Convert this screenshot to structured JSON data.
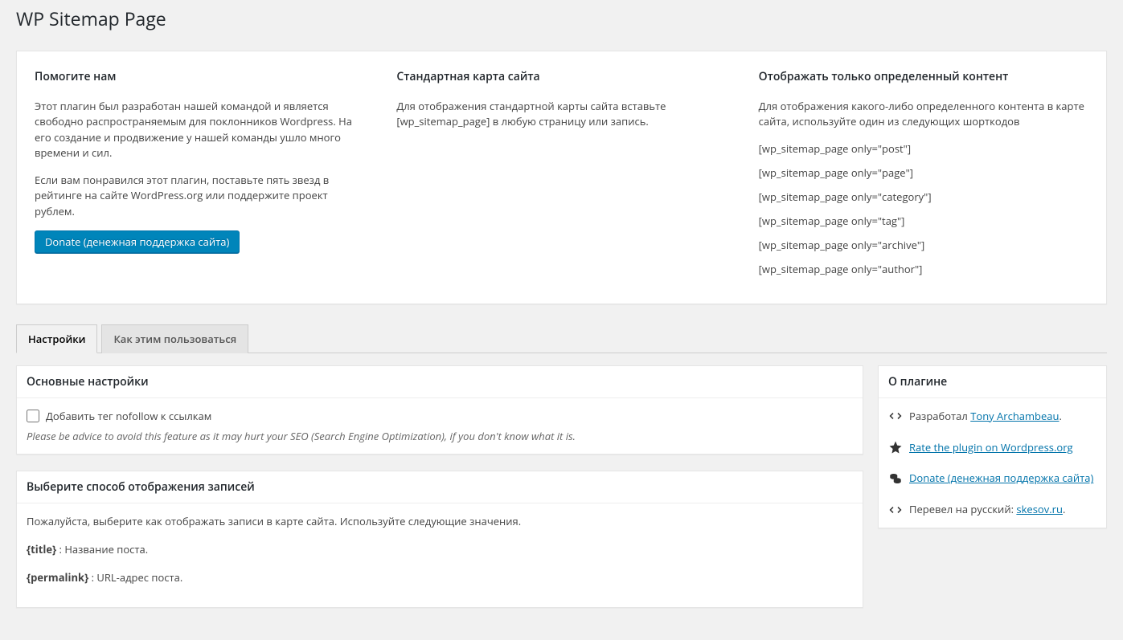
{
  "page_title": "WP Sitemap Page",
  "top": {
    "col1": {
      "heading": "Помогите нам",
      "p1": "Этот плагин был разработан нашей командой и является свободно распространяемым для поклонников Wordpress. На его создание и продвижение у нашей команды ушло много времени и сил.",
      "p2": "Если вам понравился этот плагин, поставьте пять звезд в рейтинге на сайте WordPress.org или поддержите проект рублем.",
      "donate_btn": "Donate (денежная поддержка сайта)"
    },
    "col2": {
      "heading": "Стандартная карта сайта",
      "p1": "Для отображения стандартной карты сайта вставьте [wp_sitemap_page] в любую страницу или запись."
    },
    "col3": {
      "heading": "Отображать только определенный контент",
      "p1": "Для отображения какого-либо определенного контента в карте сайта, используйте один из следующих шорткодов",
      "codes": [
        "[wp_sitemap_page only=\"post\"]",
        "[wp_sitemap_page only=\"page\"]",
        "[wp_sitemap_page only=\"category\"]",
        "[wp_sitemap_page only=\"tag\"]",
        "[wp_sitemap_page only=\"archive\"]",
        "[wp_sitemap_page only=\"author\"]"
      ]
    }
  },
  "tabs": {
    "settings": "Настройки",
    "howto": "Как этим пользоваться"
  },
  "settings_panel": {
    "heading": "Основные настройки",
    "checkbox_label": "Добавить тег nofollow к ссылкам",
    "desc": "Please be advice to avoid this feature as it may hurt your SEO (Search Engine Optimization), if you don't know what it is."
  },
  "display_panel": {
    "heading": "Выберите способ отображения записей",
    "intro": "Пожалуйста, выберите как отображать записи в карте сайта. Используйте следующие значения.",
    "t1_key": "{title}",
    "t1_val": " : Название поста.",
    "t2_key": "{permalink}",
    "t2_val": " : URL-адрес поста."
  },
  "about_panel": {
    "heading": "О плагине",
    "dev_prefix": "Разработал ",
    "dev_name": "Tony Archambeau",
    "rate": "Rate the plugin on Wordpress.org",
    "donate": "Donate (денежная поддержка сайта)",
    "trans_prefix": "Перевел на русский: ",
    "trans_name": "skesov.ru"
  }
}
